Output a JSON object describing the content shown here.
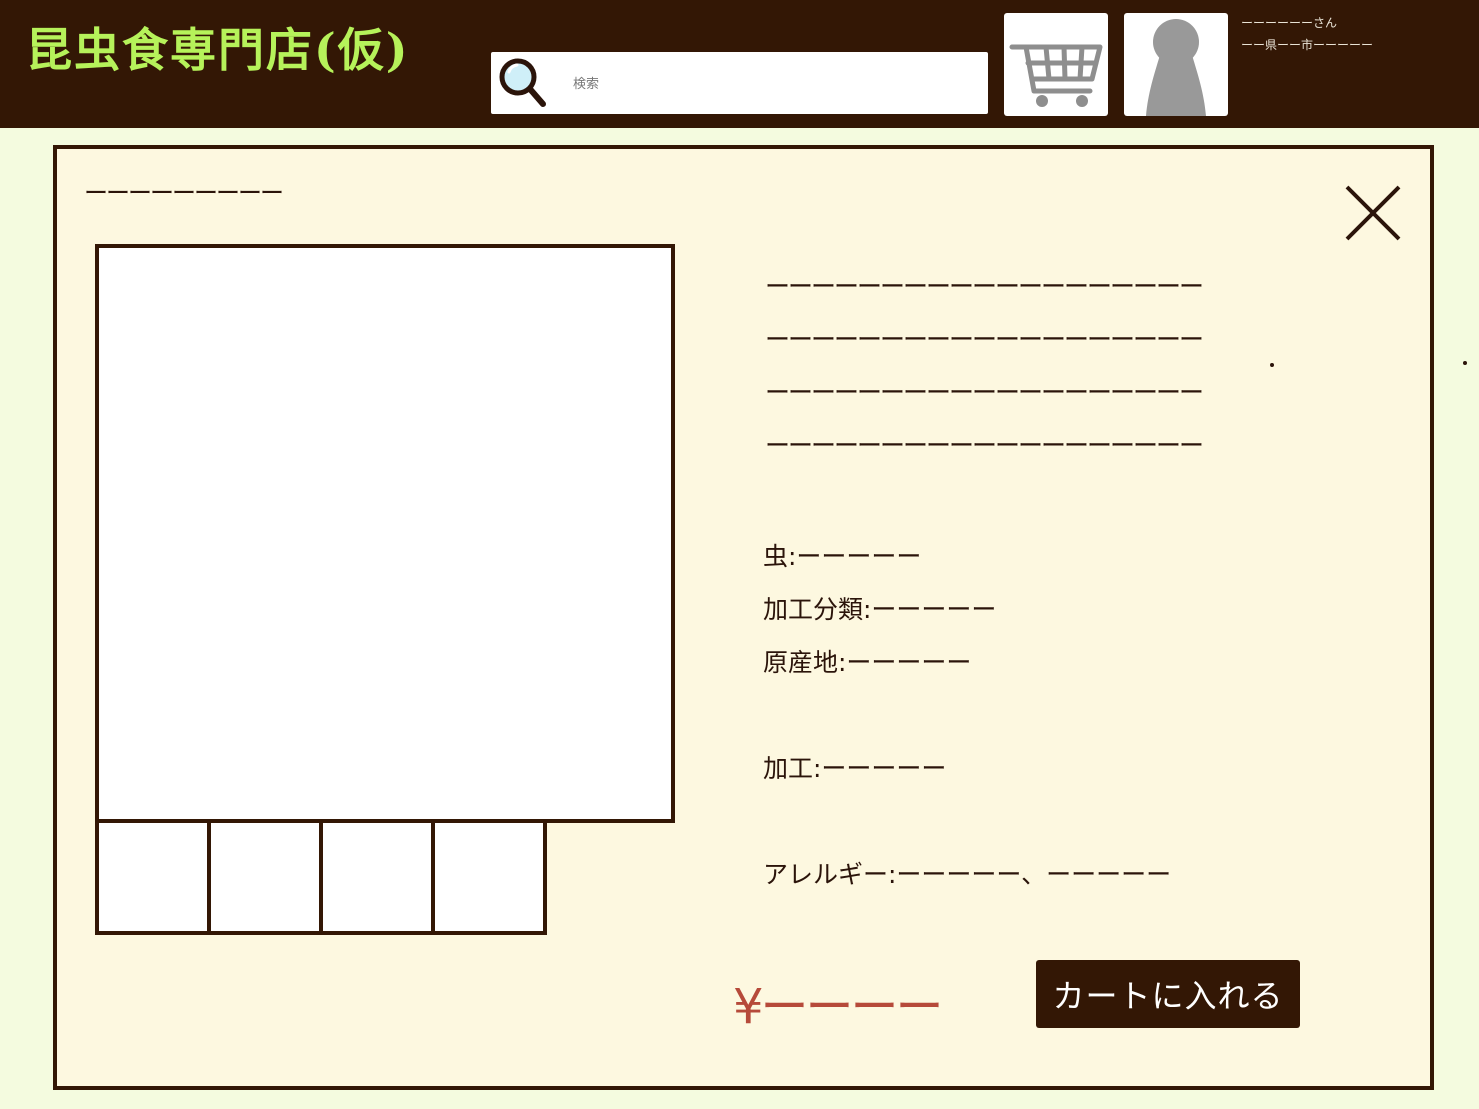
{
  "header": {
    "logo_text": "昆虫食専門店(仮)",
    "search_placeholder": "検索",
    "user_name": "ーーーーーーさん",
    "user_location": "ーー県ーー市ーーーーー"
  },
  "product": {
    "title": "ーーーーーーーーー",
    "description_lines": [
      "ーーーーーーーーーーーーーーーーーーー",
      "ーーーーーーーーーーーーーーーーーーー",
      "ーーーーーーーーーーーーーーーーーーー",
      "ーーーーーーーーーーーーーーーーーーー"
    ],
    "specs": {
      "insect": "虫:ーーーーー",
      "category": "加工分類:ーーーーー",
      "origin": "原産地:ーーーーー",
      "processing": "加工:ーーーーー",
      "allergy": "アレルギー:ーーーーー、ーーーーー"
    },
    "price": "¥ーーーー",
    "add_to_cart_label": "カートに入れる"
  },
  "colors": {
    "header_bg": "#331705",
    "page_bg": "#f4fbdf",
    "panel_bg": "#fdf8e0",
    "logo": "#b6f25a",
    "price": "#b64a3a"
  },
  "icons": {
    "search": "magnifier-icon",
    "cart": "cart-icon",
    "user": "user-avatar-icon",
    "close": "close-icon"
  }
}
